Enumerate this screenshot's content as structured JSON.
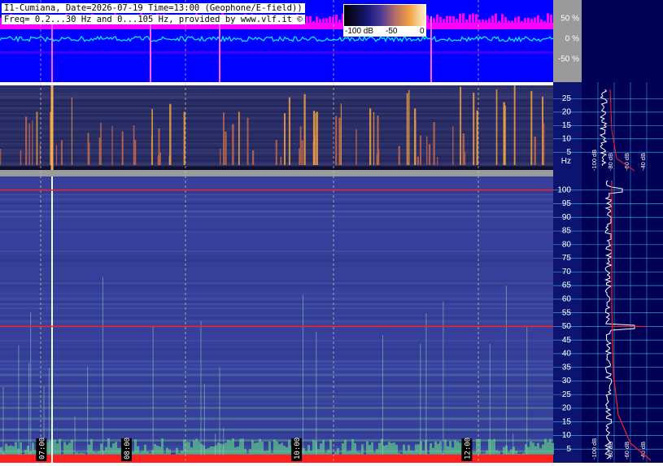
{
  "header": {
    "line1": "I1-Cumiana, Date=2026-07-19 Time=13:00 (Geophone/E-field))",
    "line2": "Freq= 0.2...30 Hz and 0...105 Hz, provided by www.vlf.it ©"
  },
  "colorbar": {
    "labels": [
      "-100 dB",
      "-50",
      "0"
    ]
  },
  "colors": {
    "waveform_bg": "#0000ff",
    "waveform_envelope": "#ff00ff",
    "waveform_trace": "#00ffff",
    "spectro_low_bg": "#2a2e66",
    "spectro_high_bg": "#36409a",
    "panel_bg": "#000055",
    "gridline": "#40c0ff",
    "marker": "#ff2020",
    "right_bg": "#0c1470"
  },
  "chart_data": [
    {
      "type": "line",
      "panel": "waveform",
      "y_ticks": [
        "50 %",
        "0 %",
        "-50 %"
      ],
      "ylim": [
        -100,
        100
      ],
      "xlim": [
        "06:30",
        "13:00"
      ]
    },
    {
      "type": "heatmap",
      "panel": "spectrogram-low",
      "ylabel": "Hz",
      "y_ticks": [
        25,
        20,
        15,
        10,
        5
      ],
      "ylim": [
        0.2,
        30
      ],
      "xlim": [
        "06:30",
        "13:00"
      ]
    },
    {
      "type": "heatmap",
      "panel": "spectrogram-high",
      "y_ticks": [
        100,
        95,
        90,
        85,
        80,
        75,
        70,
        65,
        60,
        55,
        50,
        45,
        40,
        35,
        30,
        25,
        20,
        15,
        10,
        5
      ],
      "ylim": [
        0,
        105
      ],
      "xlim": [
        "06:30",
        "13:00"
      ],
      "x_ticks": [
        "07:00",
        "08:00",
        "10:00",
        "12:00"
      ],
      "marked_lines_hz": [
        100,
        50
      ]
    },
    {
      "type": "line",
      "panel": "spectrum-low",
      "x_ticks": [
        "-100 dB",
        "-80 dB",
        "-60 dB",
        "-40 dB",
        "-20 dB"
      ]
    },
    {
      "type": "line",
      "panel": "spectrum-high",
      "x_ticks": [
        "-100 dB",
        "-80 dB",
        "-60 dB",
        "-40 dB",
        "-20 dB"
      ]
    }
  ]
}
